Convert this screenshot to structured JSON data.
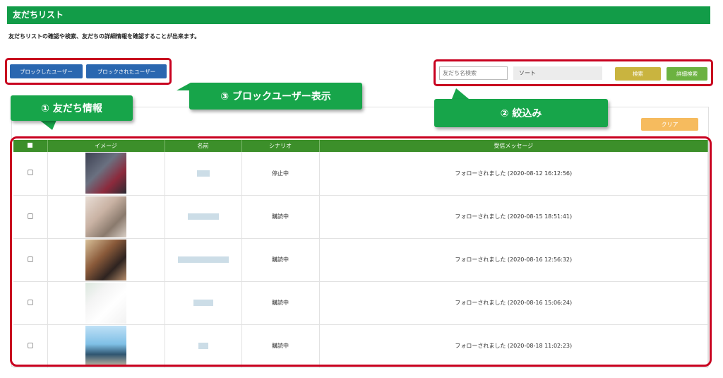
{
  "title": "友だちリスト",
  "description": "友だちリストの確認や検索、友だちの詳細情報を確認することが出来ます。",
  "buttons": {
    "blocked": "ブロックしたユーザー",
    "blocked_by": "ブロックされたユーザー",
    "search": "検索",
    "advanced_search": "詳細検索",
    "clear": "クリア"
  },
  "search": {
    "placeholder": "友だち名検索"
  },
  "sort": {
    "label": "ソート"
  },
  "callouts": {
    "info": "① 友だち情報",
    "block": "③ ブロックユーザー表示",
    "filter": "② 絞込み"
  },
  "table": {
    "headers": [
      "",
      "イメージ",
      "名前",
      "シナリオ",
      "受信メッセージ"
    ],
    "rows": [
      {
        "scenario": "停止中",
        "message": "フォローされました (2020-08-12 16:12:56)"
      },
      {
        "scenario": "購読中",
        "message": "フォローされました (2020-08-15 18:51:41)"
      },
      {
        "scenario": "購読中",
        "message": "フォローされました (2020-08-16 12:56:32)"
      },
      {
        "scenario": "購読中",
        "message": "フォローされました (2020-08-16 15:06:24)"
      },
      {
        "scenario": "購読中",
        "message": "フォローされました (2020-08-18 11:02:23)"
      }
    ]
  },
  "colors": {
    "header_green": "#129c48",
    "table_header": "#3c8f2a",
    "callout_green": "#17a54a",
    "highlight_red": "#c8001f",
    "button_blue": "#2a67b0",
    "button_yellow": "#c9b43f",
    "button_green": "#6cb241",
    "button_orange": "#f6bb5e"
  }
}
